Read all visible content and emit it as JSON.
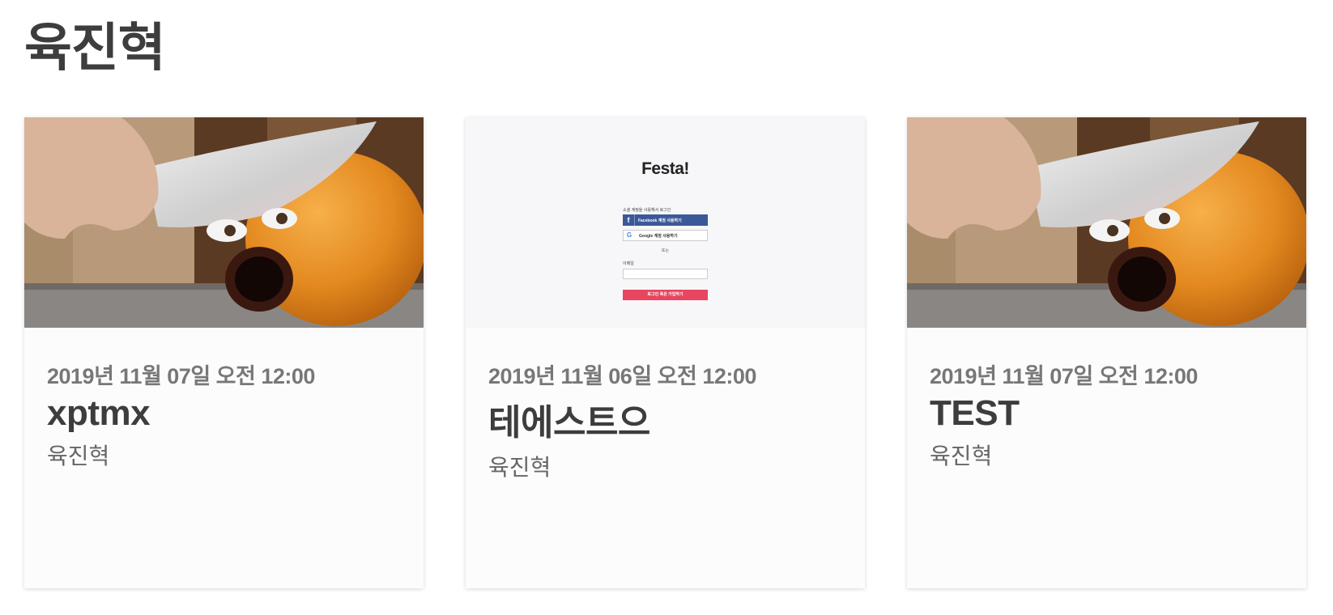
{
  "page": {
    "title": "육진혁"
  },
  "cards": [
    {
      "date": "2019년 11월 07일 오전 12:00",
      "title": "xptmx",
      "author": "육진혁",
      "thumbnail": "annoying-orange-knife-image"
    },
    {
      "date": "2019년 11월 06일 오전 12:00",
      "title": "테에스트으",
      "author": "육진혁",
      "thumbnail": "login-page-screenshot",
      "login": {
        "logo": "Festa!",
        "caption": "소셜 계정을 사용해서 로그인",
        "facebook": "Facebook 계정 사용하기",
        "google": "Google 계정 사용하기",
        "or": "또는",
        "email_label": "이메일",
        "submit": "로그인 혹은 가입하기"
      }
    },
    {
      "date": "2019년 11월 07일 오전 12:00",
      "title": "TEST",
      "author": "육진혁",
      "thumbnail": "annoying-orange-knife-image"
    }
  ],
  "colors": {
    "facebook": "#3b5998",
    "submit": "#e8465f",
    "text": "#3d3d3d",
    "muted": "#777777"
  }
}
